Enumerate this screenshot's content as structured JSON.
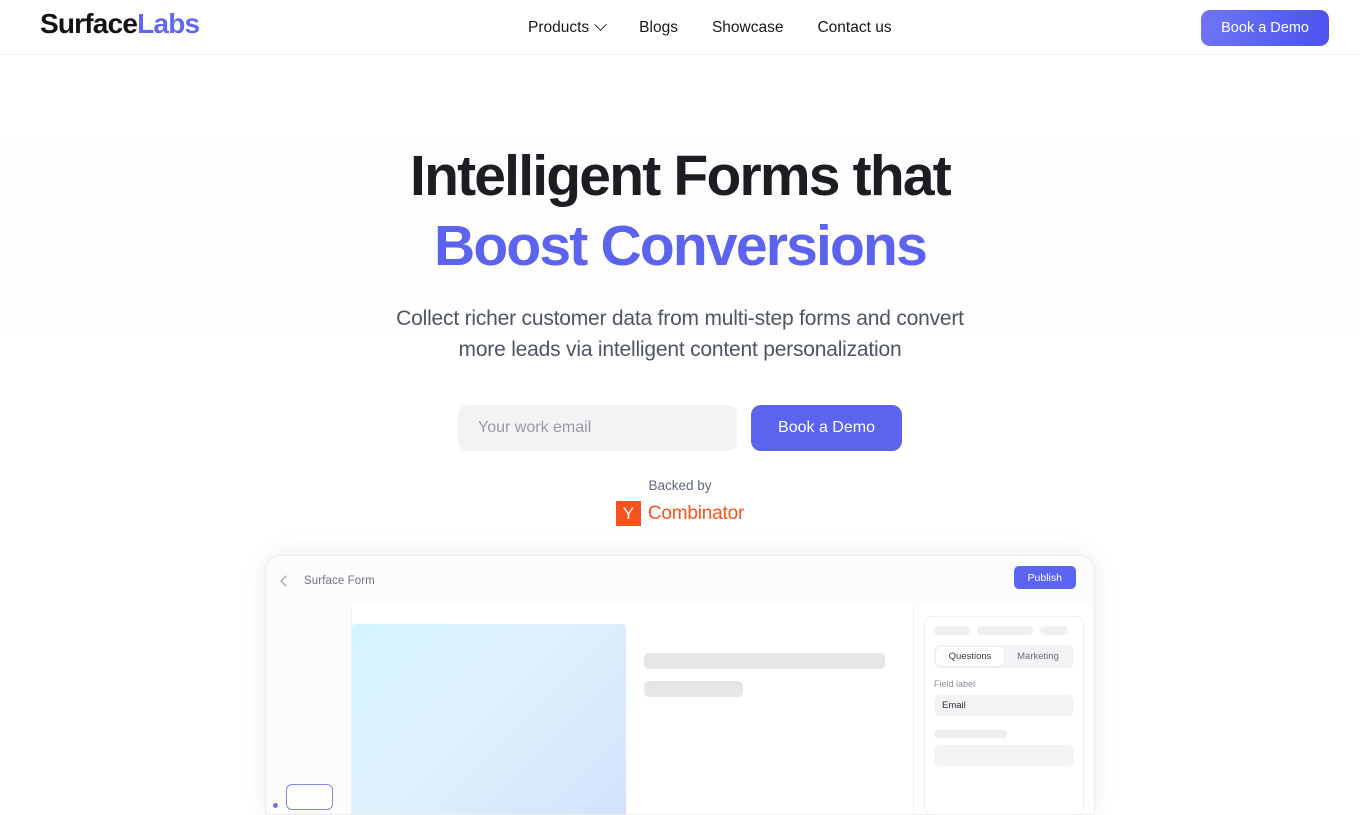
{
  "header": {
    "brand_primary": "Surface",
    "brand_secondary": "Labs",
    "nav": [
      {
        "label": "Products",
        "icon": "chevron-down-icon",
        "has_dropdown": true
      },
      {
        "label": "Blogs",
        "has_dropdown": false
      },
      {
        "label": "Showcase",
        "has_dropdown": false
      },
      {
        "label": "Contact us",
        "has_dropdown": false
      }
    ],
    "cta_label": "Book a Demo"
  },
  "hero": {
    "title_line1": "Intelligent Forms that",
    "title_line2": "Boost Conversions",
    "subtitle": "Collect richer customer data from multi-step forms and convert more leads via intelligent content personalization",
    "email_placeholder": "Your work email",
    "email_value": "",
    "cta_label": "Book a Demo",
    "backed_by_label": "Backed by",
    "investor_mark": "Y",
    "investor_name": "Combinator"
  },
  "mockup": {
    "back_icon": "chevron-left-icon",
    "title": "Surface Form",
    "publish_label": "Publish",
    "inspector": {
      "tabs": [
        {
          "label": "Questions",
          "active": true
        },
        {
          "label": "Marketing",
          "active": false
        }
      ],
      "field_label_caption": "Field label",
      "field_label_value": "Email"
    }
  },
  "colors": {
    "accent_indigo": "#5b63ef",
    "accent_indigo_light": "#6f76f5",
    "brand_dark": "#131316",
    "yc_orange": "#f8531d",
    "body_text": "#4e5561",
    "skeleton": "#e6e6e9"
  }
}
